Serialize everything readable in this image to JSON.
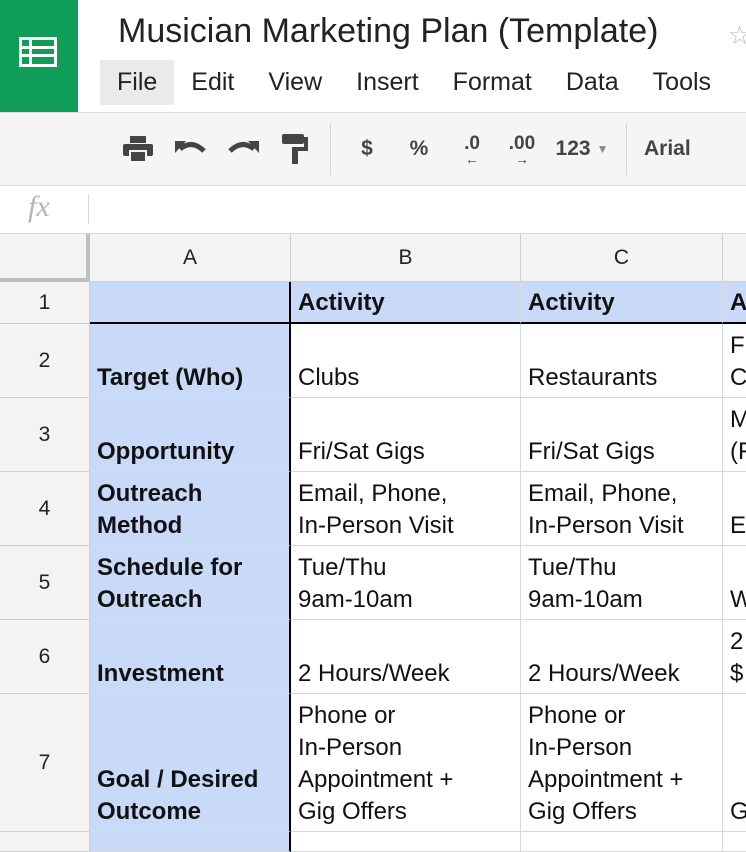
{
  "app": {
    "title": "Musician Marketing Plan (Template)",
    "star_glyph": "☆"
  },
  "menu": {
    "items": [
      "File",
      "Edit",
      "View",
      "Insert",
      "Format",
      "Data",
      "Tools"
    ]
  },
  "toolbar": {
    "currency_label": "$",
    "percent_label": "%",
    "decrease_decimal_label": ".0",
    "increase_decimal_label": ".00",
    "more_formats_label": "123",
    "font_label": "Arial"
  },
  "formula_bar": {
    "fx_label": "fx",
    "value": ""
  },
  "grid": {
    "columns": [
      "A",
      "B",
      "C"
    ],
    "rows": [
      {
        "num": "1",
        "a": "",
        "b": "Activity",
        "c": "Activity",
        "d": "A"
      },
      {
        "num": "2",
        "a": "Target (Who)",
        "b": "Clubs",
        "c": "Restaurants",
        "d": "F\nC"
      },
      {
        "num": "3",
        "a": "Opportunity",
        "b": "Fri/Sat Gigs",
        "c": "Fri/Sat Gigs",
        "d": "M\n(F"
      },
      {
        "num": "4",
        "a": "Outreach\nMethod",
        "b": "Email, Phone,\nIn-Person Visit",
        "c": "Email, Phone,\nIn-Person Visit",
        "d": "E"
      },
      {
        "num": "5",
        "a": "Schedule for\nOutreach",
        "b": "Tue/Thu\n9am-10am",
        "c": "Tue/Thu\n9am-10am",
        "d": "W"
      },
      {
        "num": "6",
        "a": "Investment",
        "b": "2 Hours/Week",
        "c": "2 Hours/Week",
        "d": "2\n$"
      },
      {
        "num": "7",
        "a": "Goal / Desired\nOutcome",
        "b": "Phone or\nIn-Person\nAppointment +\nGig Offers",
        "c": "Phone or\nIn-Person\nAppointment +\nGig Offers",
        "d": "G"
      }
    ]
  }
}
